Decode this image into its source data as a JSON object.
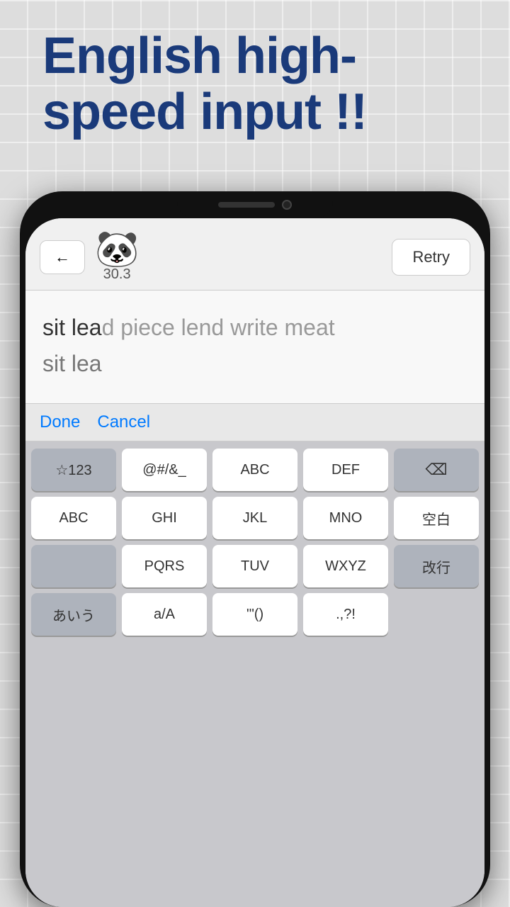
{
  "page": {
    "background_color": "#ddd"
  },
  "header": {
    "title_line1": "English high-",
    "title_line2": "speed input !!"
  },
  "phone": {
    "top_bar": {
      "back_label": "←",
      "panda_emoji": "🐼",
      "score": "30.3",
      "retry_label": "Retry"
    },
    "text_display": {
      "target_line": "sit lead piece lend write meat",
      "typed_prefix": "sit lea",
      "typed_cursor": "d",
      "typed_line": "sit lea"
    },
    "toolbar": {
      "done_label": "Done",
      "cancel_label": "Cancel"
    },
    "keyboard": {
      "rows": [
        [
          "☆123",
          "@#/&_",
          "ABC",
          "DEF",
          "⌫"
        ],
        [
          "ABC",
          "GHI",
          "JKL",
          "MNO",
          "空白"
        ],
        [
          "",
          "PQRS",
          "TUV",
          "WXYZ",
          ""
        ],
        [
          "あいう",
          "a/A",
          "'\"()",
          ".,?!",
          "改行"
        ]
      ]
    }
  }
}
